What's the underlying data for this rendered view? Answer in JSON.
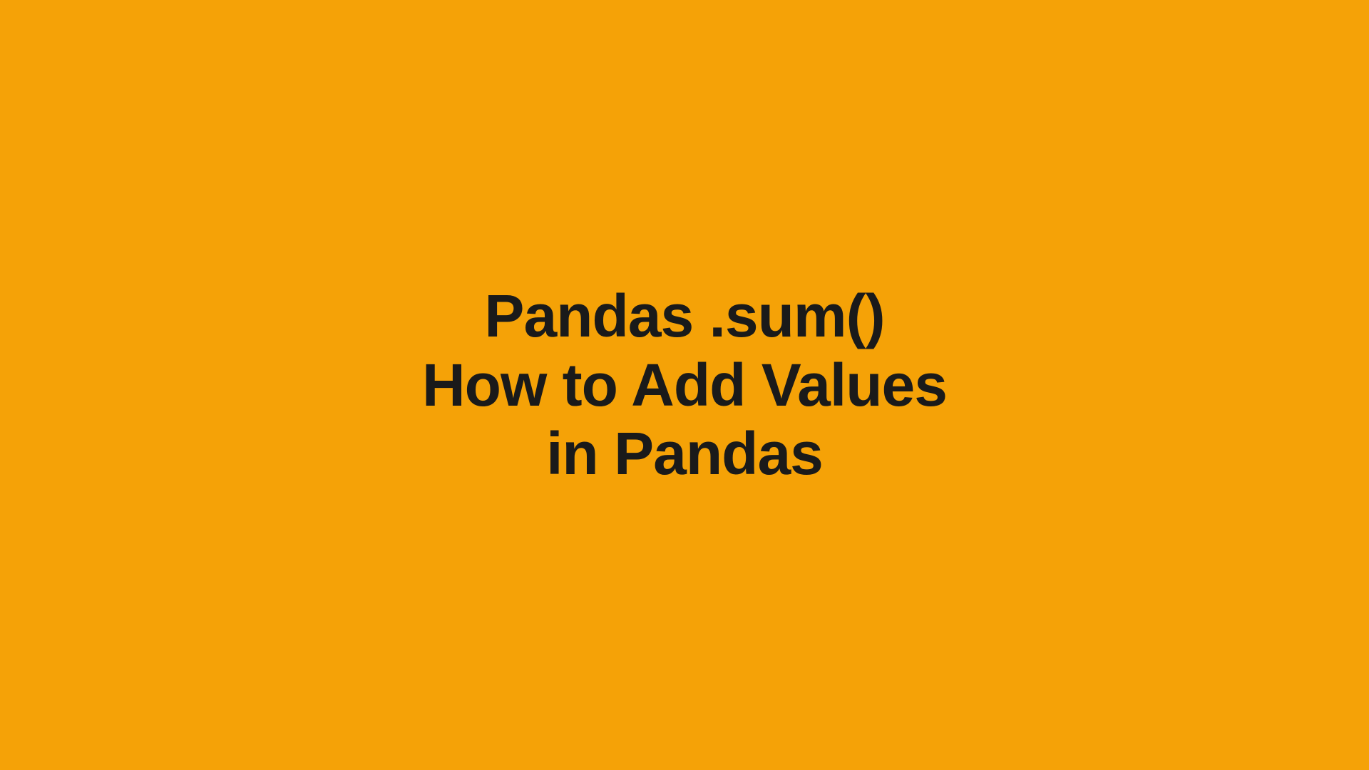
{
  "title": {
    "line1": "Pandas .sum()",
    "line2": "How to Add Values",
    "line3": "in Pandas"
  }
}
